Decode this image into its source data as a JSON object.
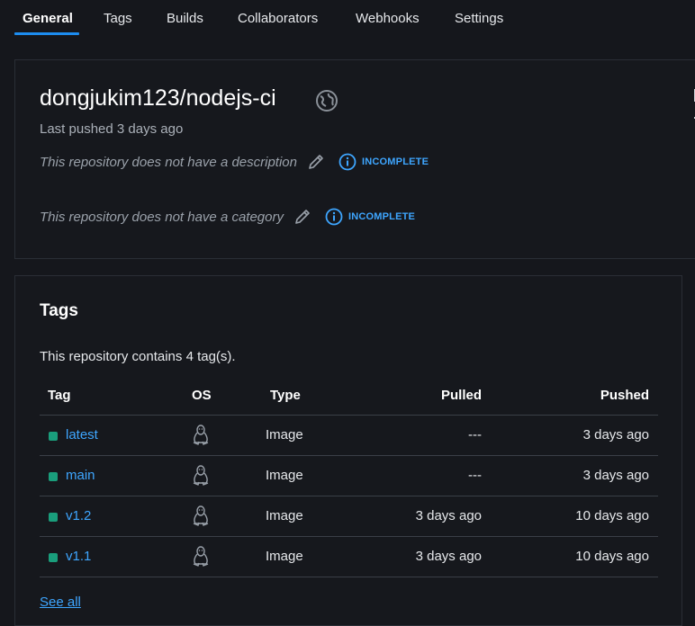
{
  "tabs": [
    {
      "label": "General",
      "active": true
    },
    {
      "label": "Tags"
    },
    {
      "label": "Builds"
    },
    {
      "label": "Collaborators"
    },
    {
      "label": "Webhooks"
    },
    {
      "label": "Settings"
    }
  ],
  "repo": {
    "name": "dongjukim123/nodejs-ci",
    "last_pushed": "Last pushed 3 days ago",
    "description_text": "This repository does not have a description",
    "category_text": "This repository does not have a category",
    "incomplete_label": "INCOMPLETE"
  },
  "tags_section": {
    "heading": "Tags",
    "count_text": "This repository contains 4 tag(s).",
    "columns": {
      "tag": "Tag",
      "os": "OS",
      "type": "Type",
      "pulled": "Pulled",
      "pushed": "Pushed"
    },
    "rows": [
      {
        "tag": "latest",
        "type": "Image",
        "pulled": "---",
        "pushed": "3 days ago"
      },
      {
        "tag": "main",
        "type": "Image",
        "pulled": "---",
        "pushed": "3 days ago"
      },
      {
        "tag": "v1.2",
        "type": "Image",
        "pulled": "3 days ago",
        "pushed": "10 days ago"
      },
      {
        "tag": "v1.1",
        "type": "Image",
        "pulled": "3 days ago",
        "pushed": "10 days ago"
      }
    ],
    "see_all": "See all"
  },
  "icons": {
    "visibility": "globe-icon",
    "edit": "pencil-icon",
    "info": "info-icon",
    "os": "linux-icon"
  },
  "colors": {
    "accent": "#1d8df0",
    "link": "#3ea6ff",
    "tag_status": "#1a9e7c",
    "background": "#15171c"
  }
}
